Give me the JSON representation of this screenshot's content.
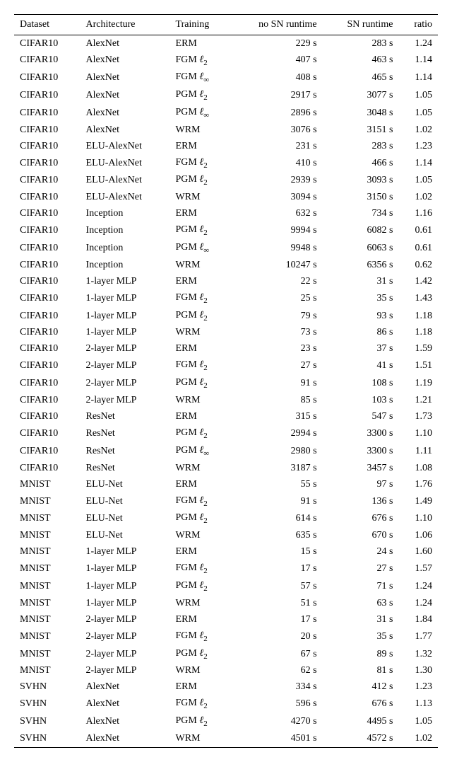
{
  "chart_data": {
    "type": "table",
    "columns": [
      "Dataset",
      "Architecture",
      "Training",
      "no SN runtime",
      "SN runtime",
      "ratio"
    ],
    "rows": [
      {
        "dataset": "CIFAR10",
        "arch": "AlexNet",
        "training": "ERM",
        "no_sn": "229 s",
        "sn": "283 s",
        "ratio": "1.24"
      },
      {
        "dataset": "CIFAR10",
        "arch": "AlexNet",
        "training": "FGM ℓ₂",
        "no_sn": "407 s",
        "sn": "463 s",
        "ratio": "1.14"
      },
      {
        "dataset": "CIFAR10",
        "arch": "AlexNet",
        "training": "FGM ℓ∞",
        "no_sn": "408 s",
        "sn": "465 s",
        "ratio": "1.14"
      },
      {
        "dataset": "CIFAR10",
        "arch": "AlexNet",
        "training": "PGM ℓ₂",
        "no_sn": "2917 s",
        "sn": "3077 s",
        "ratio": "1.05"
      },
      {
        "dataset": "CIFAR10",
        "arch": "AlexNet",
        "training": "PGM ℓ∞",
        "no_sn": "2896 s",
        "sn": "3048 s",
        "ratio": "1.05"
      },
      {
        "dataset": "CIFAR10",
        "arch": "AlexNet",
        "training": "WRM",
        "no_sn": "3076 s",
        "sn": "3151 s",
        "ratio": "1.02"
      },
      {
        "dataset": "CIFAR10",
        "arch": "ELU-AlexNet",
        "training": "ERM",
        "no_sn": "231 s",
        "sn": "283 s",
        "ratio": "1.23"
      },
      {
        "dataset": "CIFAR10",
        "arch": "ELU-AlexNet",
        "training": "FGM ℓ₂",
        "no_sn": "410 s",
        "sn": "466 s",
        "ratio": "1.14"
      },
      {
        "dataset": "CIFAR10",
        "arch": "ELU-AlexNet",
        "training": "PGM ℓ₂",
        "no_sn": "2939 s",
        "sn": "3093 s",
        "ratio": "1.05"
      },
      {
        "dataset": "CIFAR10",
        "arch": "ELU-AlexNet",
        "training": "WRM",
        "no_sn": "3094 s",
        "sn": "3150 s",
        "ratio": "1.02"
      },
      {
        "dataset": "CIFAR10",
        "arch": "Inception",
        "training": "ERM",
        "no_sn": "632 s",
        "sn": "734 s",
        "ratio": "1.16"
      },
      {
        "dataset": "CIFAR10",
        "arch": "Inception",
        "training": "PGM ℓ₂",
        "no_sn": "9994 s",
        "sn": "6082 s",
        "ratio": "0.61"
      },
      {
        "dataset": "CIFAR10",
        "arch": "Inception",
        "training": "PGM ℓ∞",
        "no_sn": "9948 s",
        "sn": "6063 s",
        "ratio": "0.61"
      },
      {
        "dataset": "CIFAR10",
        "arch": "Inception",
        "training": "WRM",
        "no_sn": "10247 s",
        "sn": "6356 s",
        "ratio": "0.62"
      },
      {
        "dataset": "CIFAR10",
        "arch": "1-layer MLP",
        "training": "ERM",
        "no_sn": "22 s",
        "sn": "31 s",
        "ratio": "1.42"
      },
      {
        "dataset": "CIFAR10",
        "arch": "1-layer MLP",
        "training": "FGM ℓ₂",
        "no_sn": "25 s",
        "sn": "35 s",
        "ratio": "1.43"
      },
      {
        "dataset": "CIFAR10",
        "arch": "1-layer MLP",
        "training": "PGM ℓ₂",
        "no_sn": "79 s",
        "sn": "93 s",
        "ratio": "1.18"
      },
      {
        "dataset": "CIFAR10",
        "arch": "1-layer MLP",
        "training": "WRM",
        "no_sn": "73 s",
        "sn": "86 s",
        "ratio": "1.18"
      },
      {
        "dataset": "CIFAR10",
        "arch": "2-layer MLP",
        "training": "ERM",
        "no_sn": "23 s",
        "sn": "37 s",
        "ratio": "1.59"
      },
      {
        "dataset": "CIFAR10",
        "arch": "2-layer MLP",
        "training": "FGM ℓ₂",
        "no_sn": "27 s",
        "sn": "41 s",
        "ratio": "1.51"
      },
      {
        "dataset": "CIFAR10",
        "arch": "2-layer MLP",
        "training": "PGM ℓ₂",
        "no_sn": "91 s",
        "sn": "108 s",
        "ratio": "1.19"
      },
      {
        "dataset": "CIFAR10",
        "arch": "2-layer MLP",
        "training": "WRM",
        "no_sn": "85 s",
        "sn": "103 s",
        "ratio": "1.21"
      },
      {
        "dataset": "CIFAR10",
        "arch": "ResNet",
        "training": "ERM",
        "no_sn": "315 s",
        "sn": "547 s",
        "ratio": "1.73"
      },
      {
        "dataset": "CIFAR10",
        "arch": "ResNet",
        "training": "PGM ℓ₂",
        "no_sn": "2994 s",
        "sn": "3300 s",
        "ratio": "1.10"
      },
      {
        "dataset": "CIFAR10",
        "arch": "ResNet",
        "training": "PGM ℓ∞",
        "no_sn": "2980 s",
        "sn": "3300 s",
        "ratio": "1.11"
      },
      {
        "dataset": "CIFAR10",
        "arch": "ResNet",
        "training": "WRM",
        "no_sn": "3187 s",
        "sn": "3457 s",
        "ratio": "1.08"
      },
      {
        "dataset": "MNIST",
        "arch": "ELU-Net",
        "training": "ERM",
        "no_sn": "55 s",
        "sn": "97 s",
        "ratio": "1.76"
      },
      {
        "dataset": "MNIST",
        "arch": "ELU-Net",
        "training": "FGM ℓ₂",
        "no_sn": "91 s",
        "sn": "136 s",
        "ratio": "1.49"
      },
      {
        "dataset": "MNIST",
        "arch": "ELU-Net",
        "training": "PGM ℓ₂",
        "no_sn": "614 s",
        "sn": "676 s",
        "ratio": "1.10"
      },
      {
        "dataset": "MNIST",
        "arch": "ELU-Net",
        "training": "WRM",
        "no_sn": "635 s",
        "sn": "670 s",
        "ratio": "1.06"
      },
      {
        "dataset": "MNIST",
        "arch": "1-layer MLP",
        "training": "ERM",
        "no_sn": "15 s",
        "sn": "24 s",
        "ratio": "1.60"
      },
      {
        "dataset": "MNIST",
        "arch": "1-layer MLP",
        "training": "FGM ℓ₂",
        "no_sn": "17 s",
        "sn": "27 s",
        "ratio": "1.57"
      },
      {
        "dataset": "MNIST",
        "arch": "1-layer MLP",
        "training": "PGM ℓ₂",
        "no_sn": "57 s",
        "sn": "71 s",
        "ratio": "1.24"
      },
      {
        "dataset": "MNIST",
        "arch": "1-layer MLP",
        "training": "WRM",
        "no_sn": "51 s",
        "sn": "63 s",
        "ratio": "1.24"
      },
      {
        "dataset": "MNIST",
        "arch": "2-layer MLP",
        "training": "ERM",
        "no_sn": "17 s",
        "sn": "31 s",
        "ratio": "1.84"
      },
      {
        "dataset": "MNIST",
        "arch": "2-layer MLP",
        "training": "FGM ℓ₂",
        "no_sn": "20 s",
        "sn": "35 s",
        "ratio": "1.77"
      },
      {
        "dataset": "MNIST",
        "arch": "2-layer MLP",
        "training": "PGM ℓ₂",
        "no_sn": "67 s",
        "sn": "89 s",
        "ratio": "1.32"
      },
      {
        "dataset": "MNIST",
        "arch": "2-layer MLP",
        "training": "WRM",
        "no_sn": "62 s",
        "sn": "81 s",
        "ratio": "1.30"
      },
      {
        "dataset": "SVHN",
        "arch": "AlexNet",
        "training": "ERM",
        "no_sn": "334 s",
        "sn": "412 s",
        "ratio": "1.23"
      },
      {
        "dataset": "SVHN",
        "arch": "AlexNet",
        "training": "FGM ℓ₂",
        "no_sn": "596 s",
        "sn": "676 s",
        "ratio": "1.13"
      },
      {
        "dataset": "SVHN",
        "arch": "AlexNet",
        "training": "PGM ℓ₂",
        "no_sn": "4270 s",
        "sn": "4495 s",
        "ratio": "1.05"
      },
      {
        "dataset": "SVHN",
        "arch": "AlexNet",
        "training": "WRM",
        "no_sn": "4501 s",
        "sn": "4572 s",
        "ratio": "1.02"
      }
    ]
  }
}
